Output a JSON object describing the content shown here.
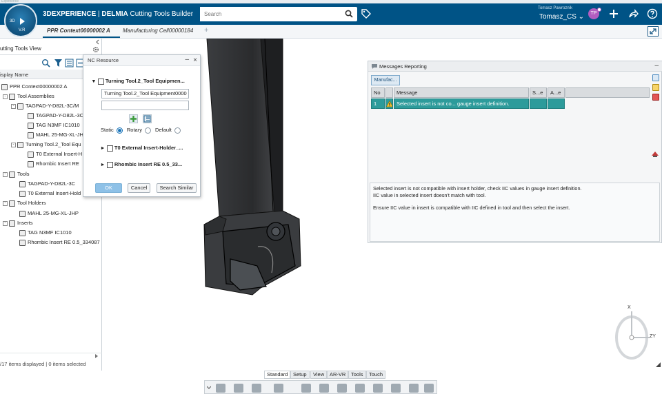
{
  "header": {
    "app_prefix": "3DEXPERIENCE",
    "app_brand": "DELMIA",
    "app_name": "Cutting Tools Builder",
    "compass_3d": "3D",
    "compass_version": "V.R",
    "search_placeholder": "Search",
    "user_full": "Tomasz Pawroznik",
    "user_tenant": "Tomasz_CS",
    "avatar_initials": "TP",
    "strip_text": "Experience",
    "icons": [
      "search-icon",
      "tag-icon",
      "add-icon",
      "share-icon",
      "help-icon"
    ]
  },
  "tabs": [
    {
      "label": "PPR Context00000002 A",
      "active": true
    },
    {
      "label": "Manufacturing Cell00000184",
      "active": false
    }
  ],
  "tab_add": "+",
  "left_panel": {
    "title": "utting Tools View",
    "column_header": "isplay Name",
    "status": "/17 items displayed | 0 items selected",
    "tree": [
      {
        "label": "PPR Context00000002 A",
        "level": 0
      },
      {
        "label": "Tool Assemblies",
        "level": 1
      },
      {
        "label": "TAGPAD-Y-D82L-3C/M",
        "level": 2
      },
      {
        "label": "TAGPAD-Y-D82L-3C",
        "level": 3
      },
      {
        "label": "TAG N3MF IC1010",
        "level": 3
      },
      {
        "label": "MAHL 25-MG-XL-JH",
        "level": 3
      },
      {
        "label": "Turning Tool.2_Tool Equ",
        "level": 2
      },
      {
        "label": "T0 External Insert-H",
        "level": 3
      },
      {
        "label": "Rhombic Insert RE",
        "level": 3
      },
      {
        "label": "Tools",
        "level": 1
      },
      {
        "label": "TAGPAD-Y-D82L-3C",
        "level": 2
      },
      {
        "label": "T0 External Insert-Hold",
        "level": 2
      },
      {
        "label": "Tool Holders",
        "level": 1
      },
      {
        "label": "MAHL 25-MG-XL-JHP",
        "level": 2
      },
      {
        "label": "Inserts",
        "level": 1
      },
      {
        "label": "TAG N3MF IC1010",
        "level": 2
      },
      {
        "label": "Rhombic Insert RE 0.5_334087",
        "level": 2
      }
    ]
  },
  "nc_dialog": {
    "title": "NC Resource",
    "header_node": "Turning Tool.2_Tool Equipmen...",
    "name_value": "Turning Tool.2_Tool Equipment0000",
    "second_value": "",
    "mode_static": "Static",
    "mode_rotary": "Rotary",
    "mode_default": "Default",
    "mode_selected": "Static",
    "child1": "T0 External Insert-Holder_...",
    "child2": "Rhombic Insert RE 0.5_33...",
    "ok": "OK",
    "cancel": "Cancel",
    "search_similar": "Search Similar"
  },
  "messages": {
    "title": "Messages Reporting",
    "filter_button": "Manufac...",
    "columns": [
      "No",
      "",
      "Message",
      "S...e",
      "A...e",
      ""
    ],
    "rows": [
      {
        "no": "1",
        "message": "Selected insert is not co... gauge insert definition.",
        "s": "",
        "a": ""
      }
    ],
    "detail_line1": "Selected insert is not compatible with insert holder, check IIC values in gauge insert definition.",
    "detail_line2": "IIC value in selected insert doesn't match with tool.",
    "detail_line3": "Ensure IIC value in insert is compatible with IIC defined in tool and then select the insert."
  },
  "bottom_tabs": [
    {
      "label": "Standard",
      "active": true
    },
    {
      "label": "Setup",
      "active": false
    },
    {
      "label": "View",
      "active": false
    },
    {
      "label": "AR-VR",
      "active": false
    },
    {
      "label": "Tools",
      "active": false
    },
    {
      "label": "Touch",
      "active": false
    }
  ],
  "axes": {
    "x": "X",
    "zy": "ZY"
  },
  "colors": {
    "header": "#005386",
    "selection": "#2d9b9b",
    "accent": "#1672b8"
  }
}
